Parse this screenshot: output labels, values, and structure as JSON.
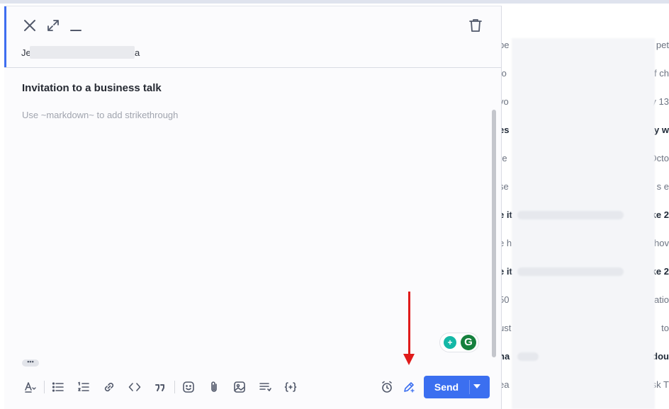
{
  "compose": {
    "to_prefix": "Je",
    "to_suffix": "a",
    "subject": "Invitation to a business talk",
    "body_placeholder": "Use ~markdown~ to add strikethrough",
    "more_label": "•••",
    "send_label": "Send"
  },
  "grammarly": {
    "bulb_glyph": "+",
    "logo_glyph": "G"
  },
  "background_list": [
    {
      "left": "be",
      "right": "pet",
      "bold": false
    },
    {
      "left": "fo",
      "right": "f ch",
      "bold": false
    },
    {
      "left": "vo",
      "right": "y 13",
      "bold": false
    },
    {
      "left": "es",
      "right": "ay w",
      "bold": true
    },
    {
      "left": "re",
      "right": "Octo",
      "bold": false
    },
    {
      "left": "se",
      "right": "s e",
      "bold": false
    },
    {
      "left": "e it",
      "right": "ke 2",
      "bold": true
    },
    {
      "left": "e h",
      "right": "hov",
      "bold": false
    },
    {
      "left": "e it",
      "right": "ke 2",
      "bold": true
    },
    {
      "left": "50",
      "right": "atio",
      "bold": false
    },
    {
      "left": "ust",
      "right": "to",
      "bold": false
    },
    {
      "left": "ha",
      "right": "dou",
      "bold": true
    },
    {
      "left": "ea",
      "right": "sk T",
      "bold": false
    }
  ],
  "colors": {
    "accent": "#3b6ff0",
    "arrow": "#e01b1b"
  }
}
